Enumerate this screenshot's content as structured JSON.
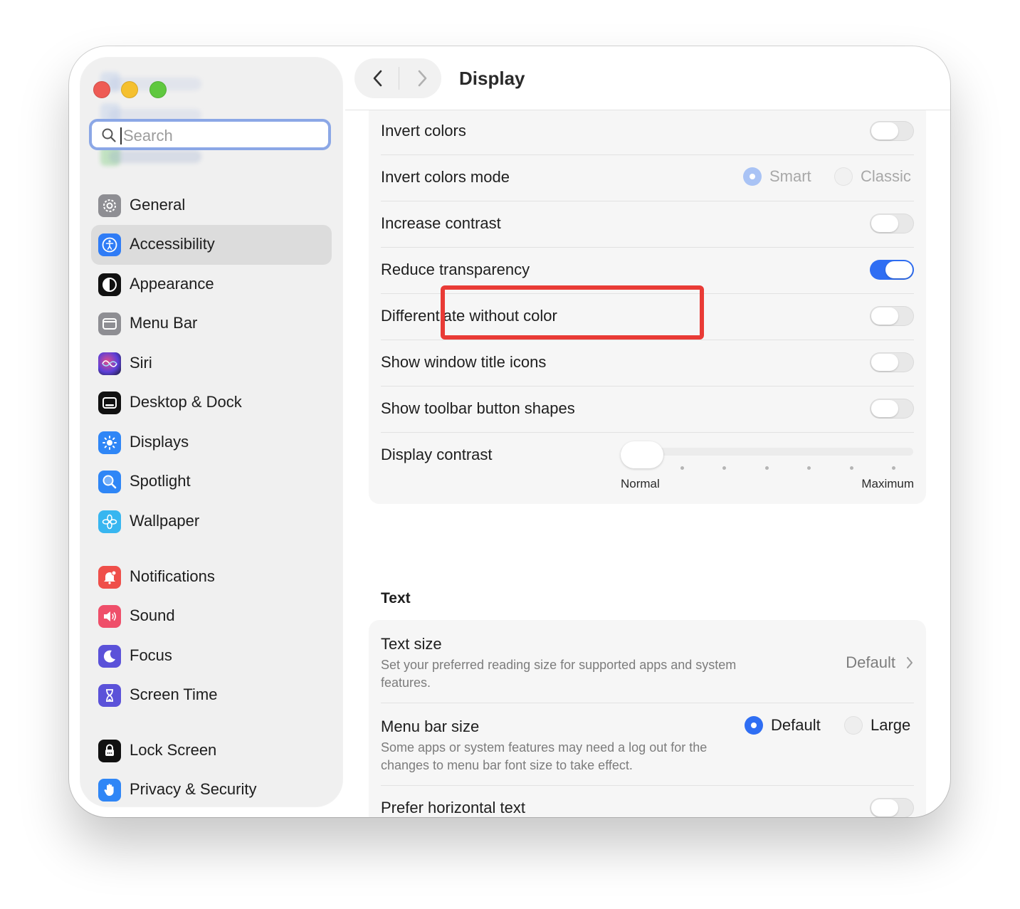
{
  "window": {
    "title": "Display"
  },
  "search": {
    "placeholder": "Search"
  },
  "sidebar": {
    "items": [
      {
        "label": "General",
        "icon": "gear-icon",
        "color": "#8e8e93"
      },
      {
        "label": "Accessibility",
        "icon": "accessibility-icon",
        "color": "#2f7cf6",
        "selected": true
      },
      {
        "label": "Appearance",
        "icon": "appearance-icon",
        "color": "#111111"
      },
      {
        "label": "Menu Bar",
        "icon": "menu-bar-icon",
        "color": "#8e8e93"
      },
      {
        "label": "Siri",
        "icon": "siri-icon",
        "color": "#6b3fd8"
      },
      {
        "label": "Desktop & Dock",
        "icon": "desktop-dock-icon",
        "color": "#111111"
      },
      {
        "label": "Displays",
        "icon": "sun-icon",
        "color": "#2f86f6"
      },
      {
        "label": "Spotlight",
        "icon": "magnifier-icon",
        "color": "#2f86f6"
      },
      {
        "label": "Wallpaper",
        "icon": "flower-icon",
        "color": "#38b6f0"
      },
      {
        "label": "Notifications",
        "icon": "bell-icon",
        "color": "#ef4f4a"
      },
      {
        "label": "Sound",
        "icon": "speaker-icon",
        "color": "#ef4f6a"
      },
      {
        "label": "Focus",
        "icon": "moon-icon",
        "color": "#5b52d9"
      },
      {
        "label": "Screen Time",
        "icon": "hourglass-icon",
        "color": "#5b52d9"
      },
      {
        "label": "Lock Screen",
        "icon": "lock-icon",
        "color": "#111111"
      },
      {
        "label": "Privacy & Security",
        "icon": "hand-icon",
        "color": "#2f86f6"
      }
    ]
  },
  "display_settings": {
    "invert_colors": {
      "label": "Invert colors",
      "on": false
    },
    "invert_colors_mode": {
      "label": "Invert colors mode",
      "options": [
        "Smart",
        "Classic"
      ],
      "selected": "Smart"
    },
    "increase_contrast": {
      "label": "Increase contrast",
      "on": false
    },
    "reduce_transparency": {
      "label": "Reduce transparency",
      "on": true
    },
    "differentiate_without_color": {
      "label": "Differentiate without color",
      "on": false
    },
    "show_window_title_icons": {
      "label": "Show window title icons",
      "on": false
    },
    "show_toolbar_button_shapes": {
      "label": "Show toolbar button shapes",
      "on": false
    },
    "display_contrast": {
      "label": "Display contrast",
      "min_label": "Normal",
      "max_label": "Maximum",
      "value": 0
    }
  },
  "text_section": {
    "heading": "Text",
    "text_size": {
      "label": "Text size",
      "description": "Set your preferred reading size for supported apps and system features.",
      "value": "Default"
    },
    "menu_bar_size": {
      "label": "Menu bar size",
      "description": "Some apps or system features may need a log out for the changes to menu bar font size to take effect.",
      "options": [
        "Default",
        "Large"
      ],
      "selected": "Default"
    },
    "prefer_horizontal_text": {
      "label": "Prefer horizontal text",
      "on": false
    }
  },
  "colors": {
    "accent": "#2f6ef3",
    "highlight": "#e93b36"
  }
}
